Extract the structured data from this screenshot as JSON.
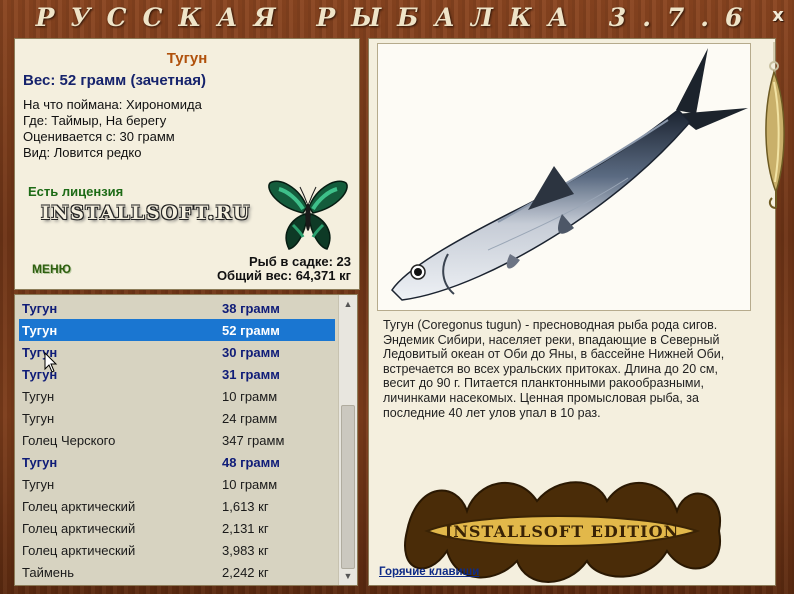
{
  "window": {
    "title": "РУССКАЯ РЫБАЛКА 3.7.6",
    "close_label": "x"
  },
  "info": {
    "fish_name": "Тугун",
    "weight_line": "Вес: 52 грамм (зачетная)",
    "details": [
      "На что поймана: Хирономида",
      "Где: Таймыр, На берегу",
      "Оценивается с: 30 грамм",
      "Вид: Ловится редко"
    ],
    "license": "Есть лицензия",
    "logo_text": "INSTALLSOFT.RU",
    "menu_label": "МЕНЮ",
    "stats": {
      "fish_in_keepnet": "Рыб в садке: 23",
      "total_weight": "Общий вес: 64,371 кг"
    }
  },
  "catch_list": [
    {
      "name": "Тугун",
      "weight": "38 грамм",
      "style": "bold"
    },
    {
      "name": "Тугун",
      "weight": "52 грамм",
      "style": "selected"
    },
    {
      "name": "Тугун",
      "weight": "30 грамм",
      "style": "bold"
    },
    {
      "name": "Тугун",
      "weight": "31 грамм",
      "style": "bold"
    },
    {
      "name": "Тугун",
      "weight": "10 грамм",
      "style": "normal"
    },
    {
      "name": "Тугун",
      "weight": "24 грамм",
      "style": "normal"
    },
    {
      "name": "Голец Черского",
      "weight": "347 грамм",
      "style": "normal"
    },
    {
      "name": "Тугун",
      "weight": "48 грамм",
      "style": "bold"
    },
    {
      "name": "Тугун",
      "weight": "10 грамм",
      "style": "normal"
    },
    {
      "name": "Голец арктический",
      "weight": "1,613 кг",
      "style": "normal"
    },
    {
      "name": "Голец арктический",
      "weight": "2,131 кг",
      "style": "normal"
    },
    {
      "name": "Голец арктический",
      "weight": "3,983 кг",
      "style": "normal"
    },
    {
      "name": "Таймень",
      "weight": "2,242 кг",
      "style": "normal"
    }
  ],
  "description": "Тугун (Coregonus tugun) - пресноводная рыба рода сигов. Эндемик Сибири, населяет реки, впадающие в Северный Ледовитый океан от Оби до Яны, в бассейне Нижней Оби, встречается во всех уральских притоках. Длина до 20 см, весит до 90 г. Питается планктонными ракообразными, личинками насекомых. Ценная промысловая рыба, за последние 40 лет улов упал в 10 раз.",
  "emblem_text": "INSTALLSOFT EDITION",
  "hotkeys_label": "Горячие клавиши",
  "colors": {
    "wood": "#6e3416",
    "panel": "#f4efde",
    "selection": "#1a76d1",
    "bold_row": "#0f1c78",
    "fish_name": "#b0510c"
  }
}
